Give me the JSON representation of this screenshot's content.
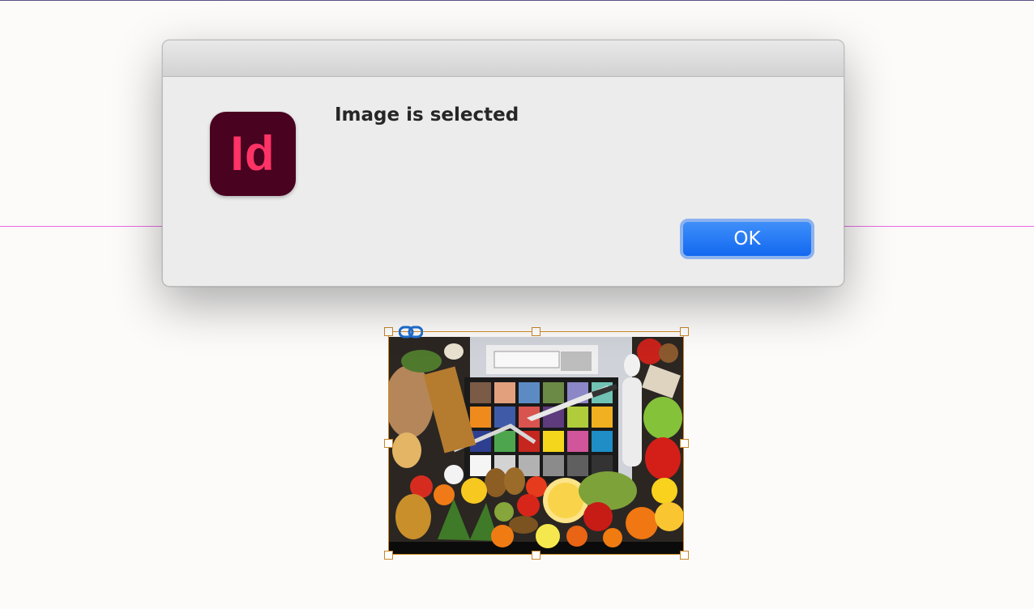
{
  "dialog": {
    "app_icon_label": "Id",
    "message": "Image is selected",
    "ok_label": "OK"
  },
  "colors": {
    "app_icon_background": "#49021f",
    "app_icon_text": "#ff3366",
    "ok_button": "#1a72f5",
    "frame_selection": "#d28b28",
    "guide": "#e86ae0"
  },
  "canvas": {
    "selected_object": "image-frame",
    "icons": [
      "link-icon"
    ]
  }
}
